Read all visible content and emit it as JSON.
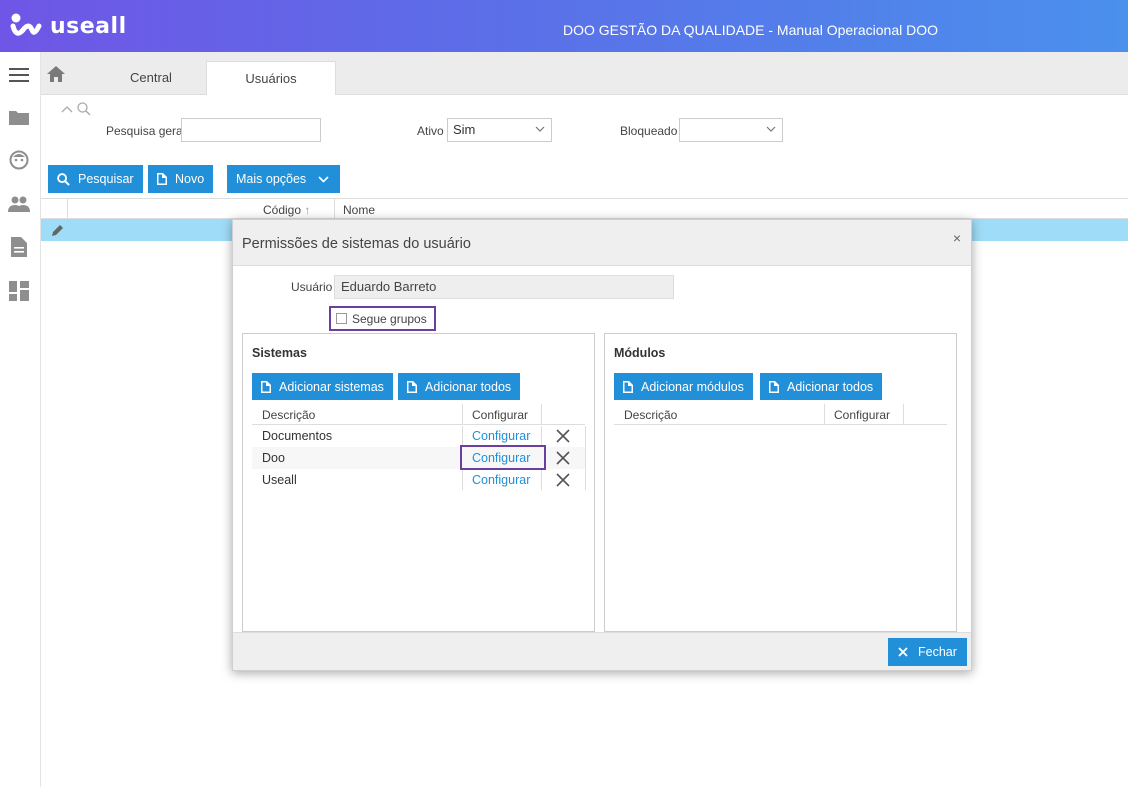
{
  "header": {
    "logo_text": "useall",
    "app_title": "DOO GESTÃO DA QUALIDADE - Manual Operacional DOO"
  },
  "sidebar": {
    "icons": [
      "menu-icon",
      "folder-icon",
      "face-icon",
      "people-icon",
      "document-icon",
      "dashboard-icon"
    ]
  },
  "tabs": {
    "home_icon": "home-icon",
    "items": [
      {
        "label": "Central",
        "active": false
      },
      {
        "label": "Usuários",
        "active": true
      }
    ]
  },
  "filters": {
    "pesquisa_label": "Pesquisa geral",
    "pesquisa_value": "",
    "ativo_label": "Ativo",
    "ativo_value": "Sim",
    "bloqueado_label": "Bloqueado",
    "bloqueado_value": ""
  },
  "toolbar": {
    "search_label": "Pesquisar",
    "new_label": "Novo",
    "more_label": "Mais opções"
  },
  "grid": {
    "columns": [
      "Código",
      "Nome"
    ]
  },
  "modal": {
    "title": "Permissões de sistemas do usuário",
    "close_symbol": "×",
    "usuario_label": "Usuário",
    "usuario_value": "Eduardo Barreto",
    "segue_grupos_label": "Segue grupos",
    "segue_grupos_checked": false,
    "sistemas": {
      "title": "Sistemas",
      "add_label": "Adicionar sistemas",
      "add_all_label": "Adicionar todos",
      "columns": [
        "Descrição",
        "Configurar"
      ],
      "rows": [
        {
          "descricao": "Documentos",
          "configurar": "Configurar"
        },
        {
          "descricao": "Doo",
          "configurar": "Configurar"
        },
        {
          "descricao": "Useall",
          "configurar": "Configurar"
        }
      ]
    },
    "modulos": {
      "title": "Módulos",
      "add_label": "Adicionar módulos",
      "add_all_label": "Adicionar todos",
      "columns": [
        "Descrição",
        "Configurar"
      ],
      "rows": []
    },
    "close_button_label": "Fechar"
  },
  "colors": {
    "primary": "#2190d9",
    "selected_row": "#9fdcf7",
    "highlight": "#6a3fa0"
  }
}
